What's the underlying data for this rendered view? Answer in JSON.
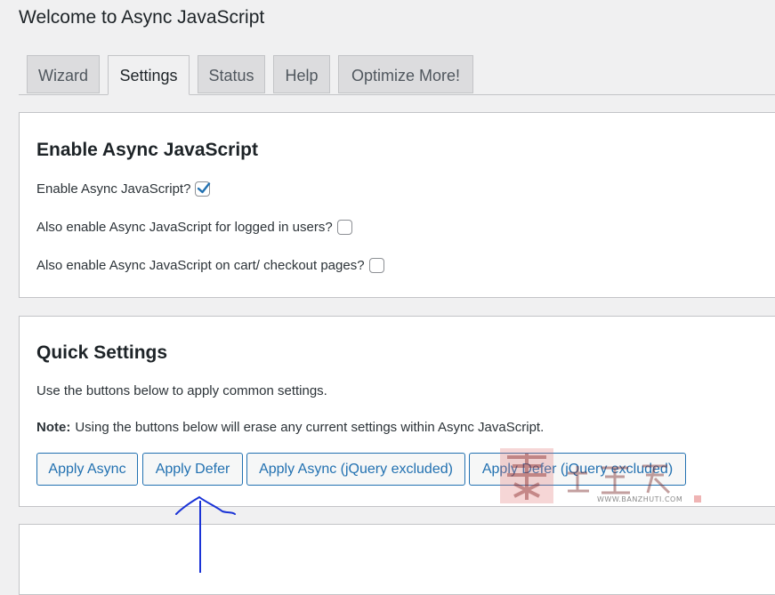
{
  "page": {
    "title": "Welcome to Async JavaScript"
  },
  "tabs": [
    {
      "label": "Wizard",
      "active": false
    },
    {
      "label": "Settings",
      "active": true
    },
    {
      "label": "Status",
      "active": false
    },
    {
      "label": "Help",
      "active": false
    },
    {
      "label": "Optimize More!",
      "active": false
    }
  ],
  "enable_section": {
    "heading": "Enable Async JavaScript",
    "options": [
      {
        "label": "Enable Async JavaScript?",
        "checked": true
      },
      {
        "label": "Also enable Async JavaScript for logged in users?",
        "checked": false
      },
      {
        "label": "Also enable Async JavaScript on cart/ checkout pages?",
        "checked": false
      }
    ]
  },
  "quick_settings": {
    "heading": "Quick Settings",
    "description": "Use the buttons below to apply common settings.",
    "note_label": "Note:",
    "note_text": "Using the buttons below will erase any current settings within Async JavaScript.",
    "buttons": [
      {
        "label": "Apply Async"
      },
      {
        "label": "Apply Defer"
      },
      {
        "label": "Apply Async (jQuery excluded)"
      },
      {
        "label": "Apply Defer (jQuery excluded)"
      }
    ]
  },
  "watermark": {
    "text": "WWW.BANZHUTI.COM"
  },
  "colors": {
    "background": "#f0f0f1",
    "card": "#ffffff",
    "accent": "#2271b1",
    "annotation": "#1a33d6"
  },
  "icons": {
    "checkbox_check": "check-icon"
  }
}
